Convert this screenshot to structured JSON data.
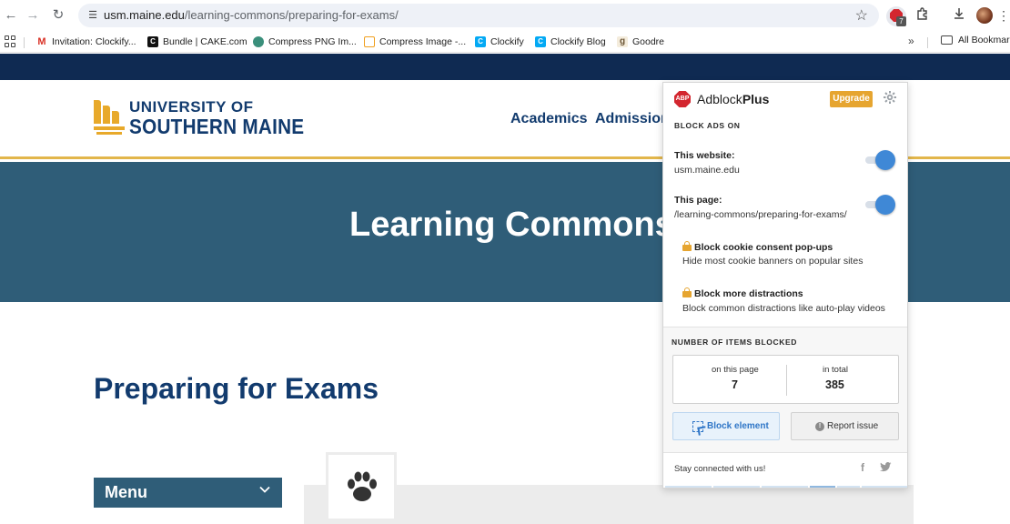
{
  "browser": {
    "url_host": "usm.maine.edu",
    "url_path": "/learning-commons/preparing-for-exams/",
    "extension_badge": "7",
    "icons": [
      "back-icon",
      "forward-icon",
      "reload-icon",
      "site-info-icon",
      "star-icon",
      "adblock-extension-icon",
      "extensions-puzzle-icon",
      "download-icon",
      "profile-avatar",
      "more-menu-icon"
    ]
  },
  "bookmarks": {
    "items": [
      {
        "label": "Invitation: Clockify...",
        "icon": "gmail-icon",
        "color": "#d93025",
        "glyph": "M"
      },
      {
        "label": "Bundle | CAKE.com",
        "icon": "cake-icon",
        "color": "#111111",
        "glyph": "C"
      },
      {
        "label": "Compress PNG Im...",
        "icon": "tinypng-panda-icon",
        "color": "#3a8f7b",
        "glyph": "•"
      },
      {
        "label": "Compress Image -...",
        "icon": "compress-image-icon",
        "color": "#f0a020",
        "glyph": "□"
      },
      {
        "label": "Clockify",
        "icon": "clockify-icon",
        "color": "#03a9f4",
        "glyph": "C"
      },
      {
        "label": "Clockify Blog",
        "icon": "clockify-blog-icon",
        "color": "#03a9f4",
        "glyph": "C"
      },
      {
        "label": "Goodre",
        "icon": "goodreads-icon",
        "color": "#b49a6b",
        "glyph": "g"
      }
    ],
    "more": "»",
    "all_bookmarks": "All Bookmarks"
  },
  "site": {
    "logo_line1": "UNIVERSITY OF",
    "logo_line2": "SOUTHERN MAINE",
    "nav": [
      "Academics",
      "Admission"
    ],
    "hero_title": "Learning Commons",
    "page_title": "Preparing for Exams",
    "menu_label": "Menu",
    "colors": {
      "navy": "#0f2a52",
      "teal": "#2f5d78",
      "gold": "#e8a92a"
    }
  },
  "adblock": {
    "brand_plain": "Adblock",
    "brand_bold": "Plus",
    "logo_text": "ABP",
    "upgrade_label": "Upgrade",
    "block_ads_caption": "BLOCK ADS ON",
    "website_label": "This website:",
    "website_value": "usm.maine.edu",
    "website_toggle_on": true,
    "page_label": "This page:",
    "page_value": "/learning-commons/preparing-for-exams/",
    "page_toggle_on": true,
    "features": [
      {
        "title": "Block cookie consent pop-ups",
        "desc": "Hide most cookie banners on popular sites",
        "locked": true
      },
      {
        "title": "Block more distractions",
        "desc": "Block common distractions like auto-play videos",
        "locked": true
      }
    ],
    "stats_caption": "NUMBER OF ITEMS BLOCKED",
    "on_page_label": "on this page",
    "on_page_value": "7",
    "total_label": "in total",
    "total_value": "385",
    "block_element_label": "Block element",
    "report_issue_label": "Report issue",
    "stay_connected": "Stay connected with us!",
    "colors": {
      "red": "#d3262f",
      "blue": "#3f88d6",
      "upgrade": "#e6a530"
    }
  }
}
